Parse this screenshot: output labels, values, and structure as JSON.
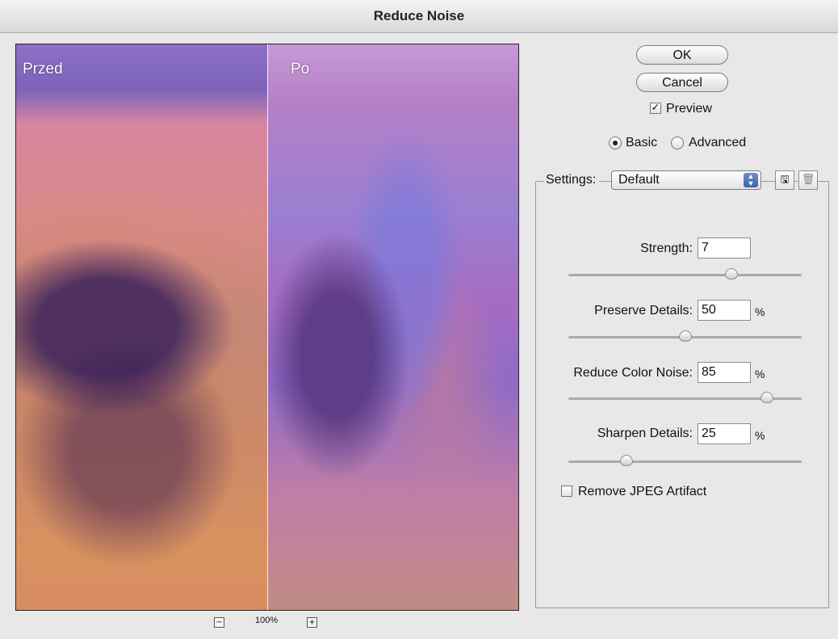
{
  "window": {
    "title": "Reduce Noise"
  },
  "preview": {
    "before_label": "Przed",
    "after_label": "Po",
    "zoom_level": "100%"
  },
  "buttons": {
    "ok": "OK",
    "cancel": "Cancel"
  },
  "preview_checkbox": {
    "label": "Preview",
    "checked": true
  },
  "mode": {
    "basic": "Basic",
    "advanced": "Advanced",
    "selected": "basic"
  },
  "settings": {
    "label": "Settings:",
    "selected": "Default"
  },
  "controls": [
    {
      "label": "Strength:",
      "value": "7",
      "unit": "",
      "slider_fraction": 0.7
    },
    {
      "label": "Preserve Details:",
      "value": "50",
      "unit": "%",
      "slider_fraction": 0.5
    },
    {
      "label": "Reduce Color Noise:",
      "value": "85",
      "unit": "%",
      "slider_fraction": 0.85
    },
    {
      "label": "Sharpen Details:",
      "value": "25",
      "unit": "%",
      "slider_fraction": 0.25
    }
  ],
  "remove_jpeg": {
    "label": "Remove JPEG Artifact",
    "checked": false
  },
  "icons": {
    "save": "save-settings-icon",
    "delete": "trash-icon",
    "zoom_out": "minus-icon",
    "zoom_in": "plus-icon"
  }
}
